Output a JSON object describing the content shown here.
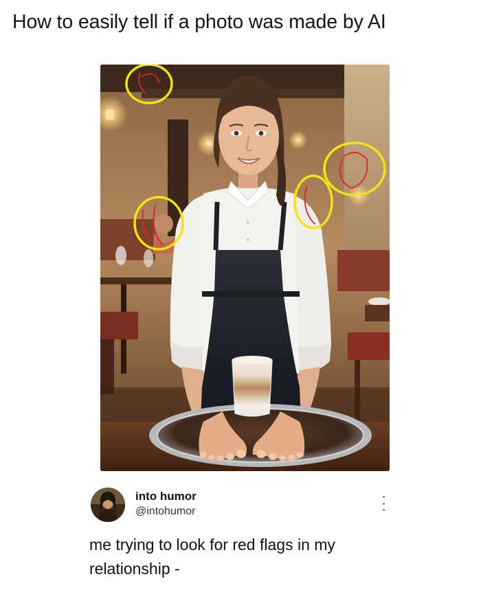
{
  "header": {
    "title": "How to easily tell if a photo was made by AI"
  },
  "tweet": {
    "display_name": "into humor",
    "handle": "@intohumor",
    "text": "me trying to look for red flags in my relationship -",
    "more_icon": "more-vertical-icon"
  },
  "colors": {
    "circle_yellow": "#f2e21a",
    "circle_red": "#d8262b",
    "apron": "#1d2128",
    "shirt": "#f3f1ee",
    "background": "#ffffff"
  }
}
